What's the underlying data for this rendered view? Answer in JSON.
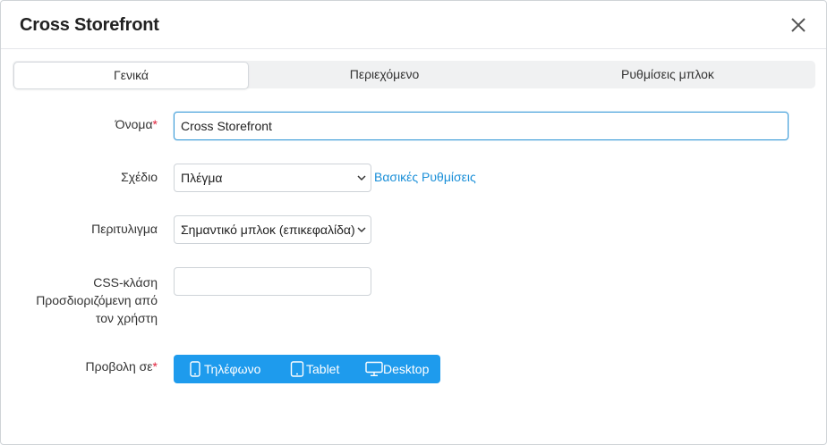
{
  "dialog": {
    "title": "Cross Storefront"
  },
  "tabs": [
    {
      "label": "Γενικά",
      "active": true
    },
    {
      "label": "Περιεχόμενο",
      "active": false
    },
    {
      "label": "Ρυθμίσεις μπλοκ",
      "active": false
    }
  ],
  "form": {
    "name": {
      "label": "Όνομα",
      "required": true,
      "value": "Cross Storefront"
    },
    "template": {
      "label": "Σχέδιο",
      "value": "Πλέγμα",
      "settings_link": "Βασικές Ρυθμίσεις"
    },
    "wrapper": {
      "label": "Περιτυλιγμα",
      "value": "Σημαντικό μπλοκ (επικεφαλίδα)"
    },
    "css_class": {
      "label_line1": "CSS-κλάση",
      "label_line2": "Προσδιοριζόμενη από",
      "label_line3": "τον χρήστη",
      "value": ""
    },
    "display_on": {
      "label": "Προβολη σε",
      "required": true,
      "options": [
        {
          "label": "Τηλέφωνο",
          "icon": "phone-icon"
        },
        {
          "label": "Tablet",
          "icon": "tablet-icon"
        },
        {
          "label": "Desktop",
          "icon": "desktop-icon"
        }
      ]
    }
  },
  "colors": {
    "accent": "#1e9bed",
    "link": "#1a8fd8",
    "required": "#e0203a"
  }
}
